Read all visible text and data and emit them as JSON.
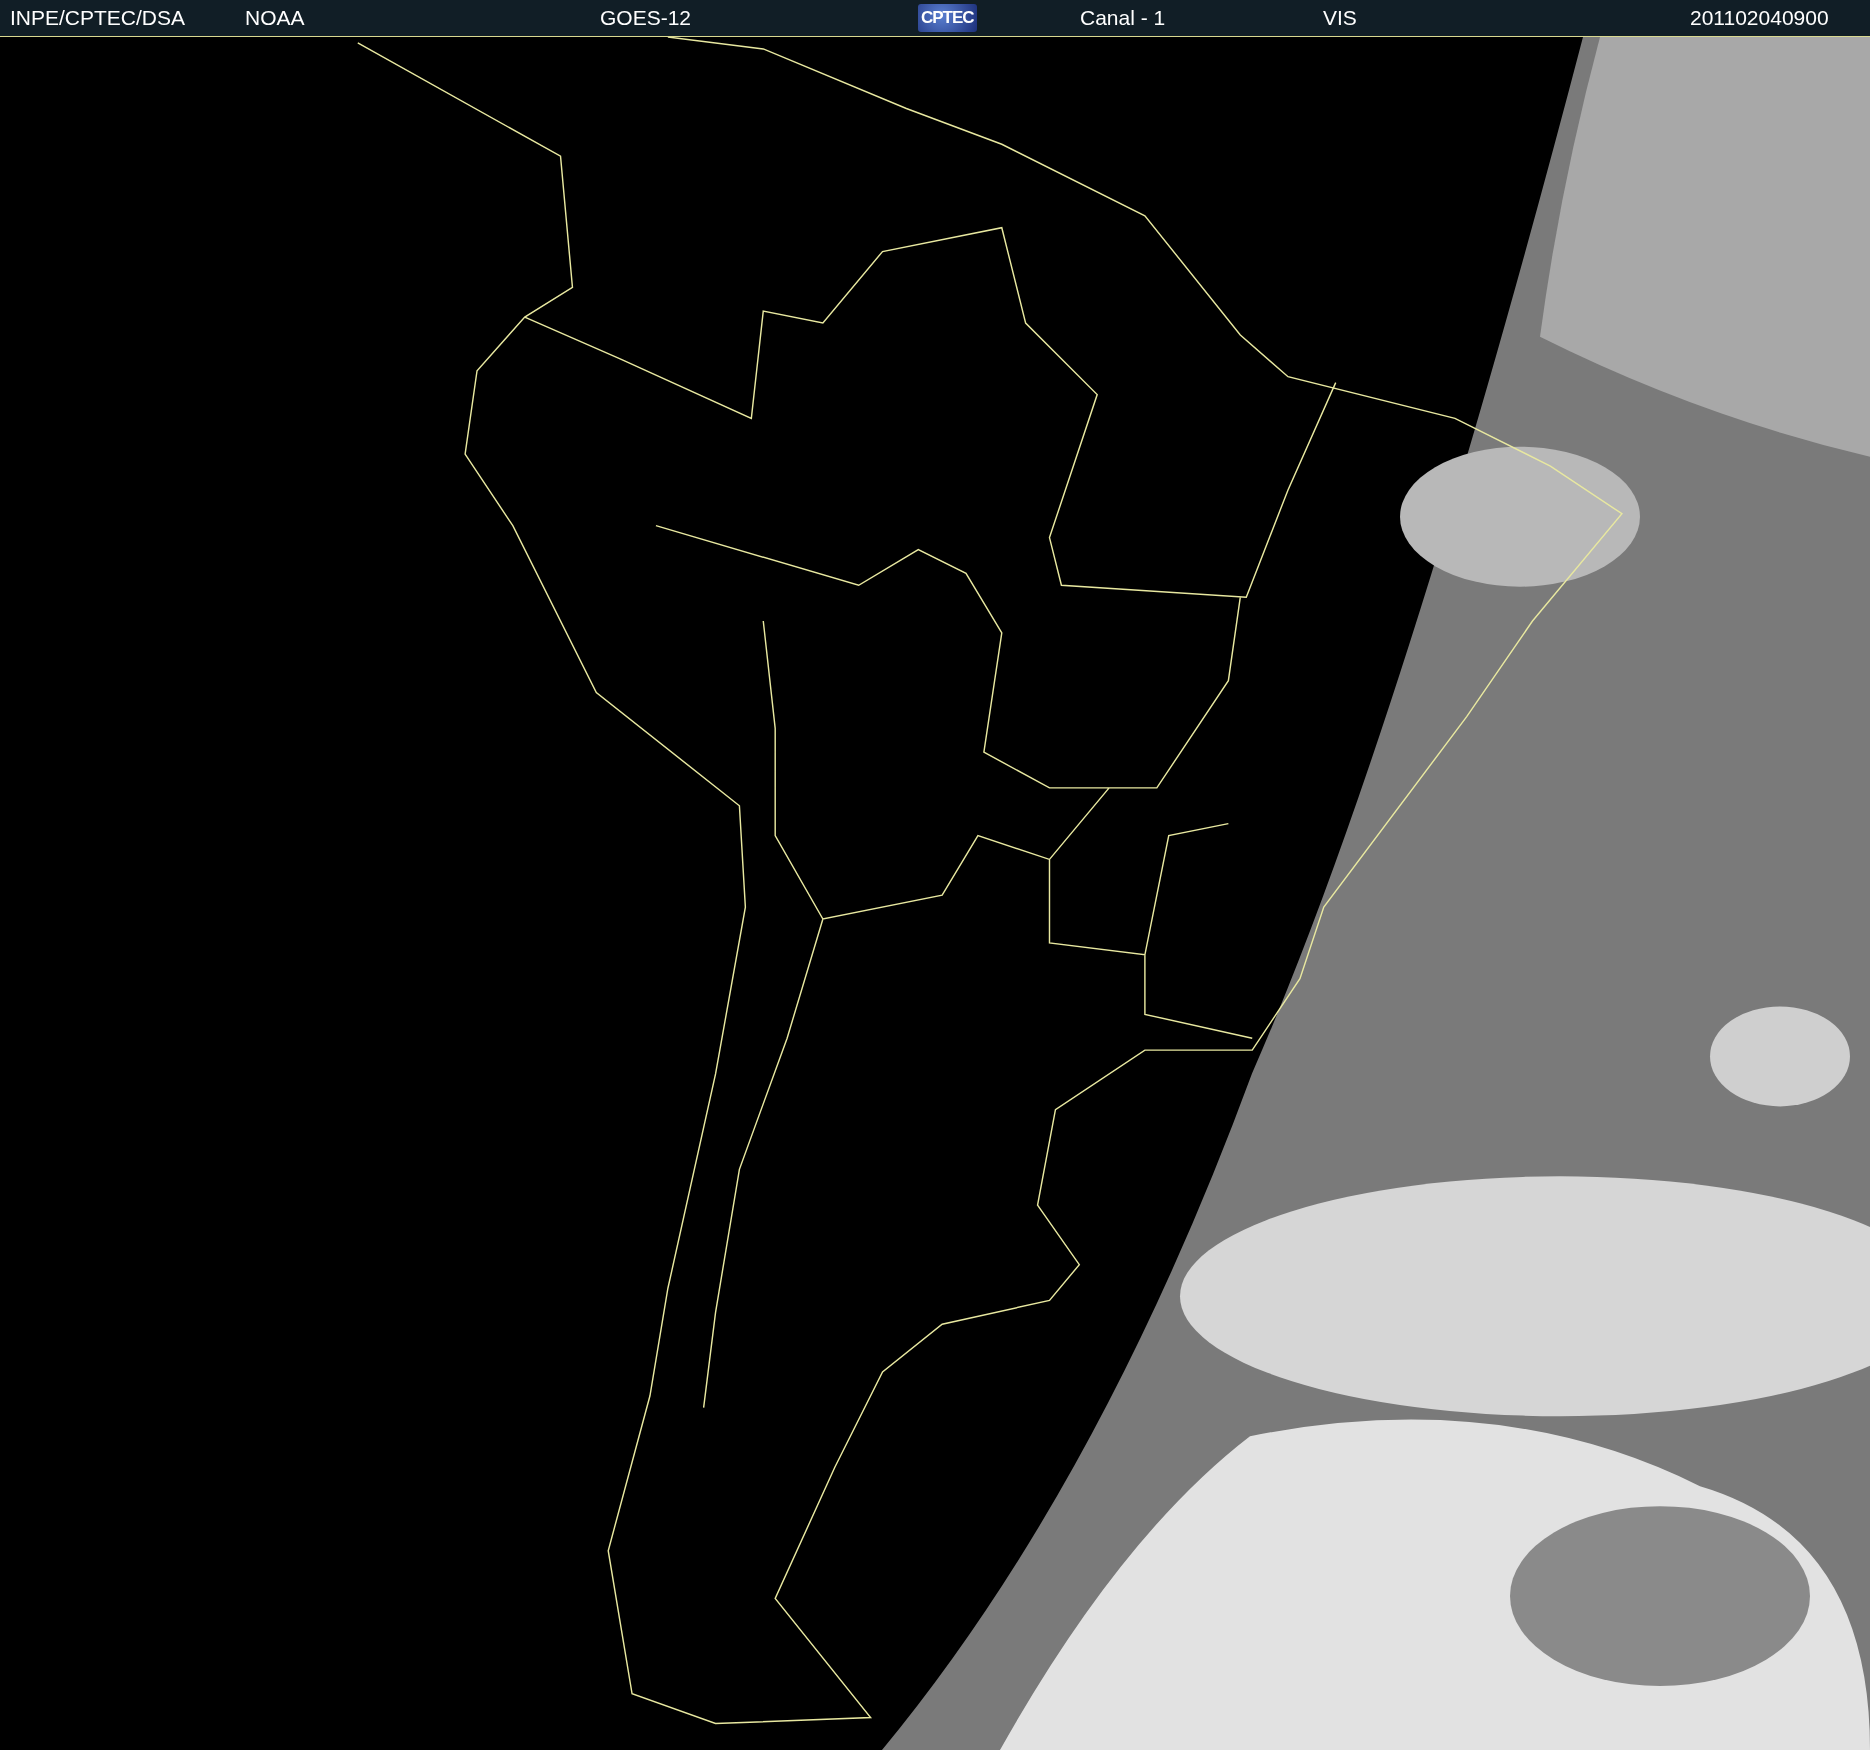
{
  "header": {
    "items": [
      {
        "kind": "text",
        "text": "INPE/CPTEC/DSA"
      },
      {
        "kind": "text",
        "text": "NOAA"
      },
      {
        "kind": "text",
        "text": "GOES-12"
      },
      {
        "kind": "logo",
        "text": "CPTEC"
      },
      {
        "kind": "text",
        "text": "Canal - 1"
      },
      {
        "kind": "text",
        "text": "VIS"
      },
      {
        "kind": "text",
        "text": "201102040900"
      }
    ]
  }
}
